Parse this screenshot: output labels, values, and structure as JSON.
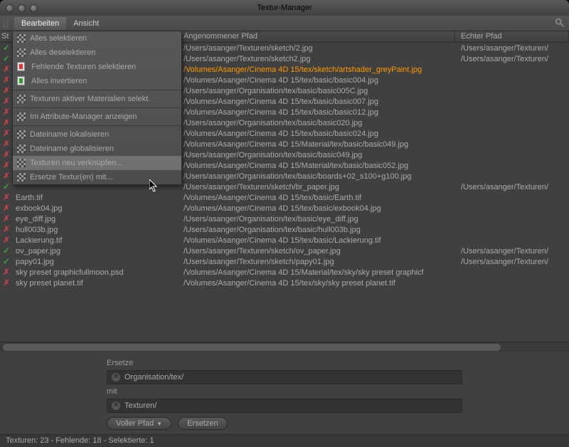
{
  "title": "Textur-Manager",
  "menu": {
    "edit": "Bearbeiten",
    "view": "Ansicht"
  },
  "cols": {
    "st": "St",
    "tex": "",
    "path": "Angenommener Pfad",
    "real": "Echter Pfad"
  },
  "dd": [
    "Alles selektieren",
    "Alles deselektieren",
    "Fehlende Texturen selektieren",
    "Alles invertieren",
    "Texturen aktiver Materialien selekt.",
    "Im Attribute-Manager anzeigen",
    "Dateiname lokalisieren",
    "Dateiname globalisieren",
    "Texturen neu verknüpfen...",
    "Ersetze Textur(en) mit..."
  ],
  "rows": [
    {
      "s": "ok",
      "p": "/Users/asanger/Texturen/sketch/2.jpg",
      "r": "/Users/asanger/Texturen/"
    },
    {
      "s": "ok",
      "p": "/Users/asanger/Texturen/sketch2.jpg",
      "r": "/Users/asanger/Texturen/"
    },
    {
      "s": "miss",
      "p": "/Volumes/Asanger/Cinema 4D 15/tex/sketch/artshader_greyPaint.jpg",
      "hl": true
    },
    {
      "s": "miss",
      "p": "/Volumes/Asanger/Cinema 4D 15/tex/basic/basic004.jpg"
    },
    {
      "s": "miss",
      "p": "/Users/asanger/Organisation/tex/basic/basic005C.jpg"
    },
    {
      "s": "miss",
      "p": "/Volumes/Asanger/Cinema 4D 15/tex/basic/basic007.jpg"
    },
    {
      "s": "miss",
      "p": "/Volumes/Asanger/Cinema 4D 15/tex/basic/basic012.jpg"
    },
    {
      "s": "miss",
      "p": "/Users/asanger/Organisation/tex/basic/basic020.jpg"
    },
    {
      "s": "miss",
      "p": "/Volumes/Asanger/Cinema 4D 15/tex/basic/basic024.jpg"
    },
    {
      "s": "miss",
      "p": "/Volumes/Asanger/Cinema 4D 15/Material/tex/basic/basic049.jpg"
    },
    {
      "s": "miss",
      "p": "/Users/asanger/Organisation/tex/basic/basic049.jpg"
    },
    {
      "s": "miss",
      "p": "/Volumes/Asanger/Cinema 4D 15/Material/tex/basic/basic052.jpg"
    },
    {
      "s": "miss",
      "p": "/Users/asanger/Organisation/tex/basic/boards+02_s100+g100.jpg"
    },
    {
      "s": "ok",
      "t": "",
      "p": "/Users/asanger/Texturen/sketch/br_paper.jpg",
      "r": "/Users/asanger/Texturen/"
    },
    {
      "s": "miss",
      "t": "Earth.tif",
      "p": "/Volumes/Asanger/Cinema 4D 15/tex/basic/Earth.tif"
    },
    {
      "s": "miss",
      "t": "exbook04.jpg",
      "p": "/Volumes/Asanger/Cinema 4D 15/tex/basic/exbook04.jpg"
    },
    {
      "s": "miss",
      "t": "eye_diff.jpg",
      "p": "/Users/asanger/Organisation/tex/basic/eye_diff.jpg"
    },
    {
      "s": "miss",
      "t": "hull003b.jpg",
      "p": "/Users/asanger/Organisation/tex/basic/hull003b.jpg"
    },
    {
      "s": "miss",
      "t": "Lackierung.tif",
      "p": "/Volumes/Asanger/Cinema 4D 15/tex/basic/Lackierung.tif"
    },
    {
      "s": "ok",
      "t": "ov_paper.jpg",
      "p": "/Users/asanger/Texturen/sketch/ov_paper.jpg",
      "r": "/Users/asanger/Texturen/"
    },
    {
      "s": "ok",
      "t": "papy01.jpg",
      "p": "/Users/asanger/Texturen/sketch/papy01.jpg",
      "r": "/Users/asanger/Texturen/"
    },
    {
      "s": "miss",
      "t": "sky preset graphicfullmoon.psd",
      "p": "/Volumes/Asanger/Cinema 4D 15/Material/tex/sky/sky preset graphicf"
    },
    {
      "s": "miss",
      "t": "sky preset planet.tif",
      "p": "/Volumes/Asanger/Cinema 4D 15/tex/sky/sky preset planet.tif"
    }
  ],
  "replace": {
    "l1": "Ersetze",
    "v1": "Organisation/tex/",
    "l2": "mit",
    "v2": "Texturen/",
    "mode": "Voller Pfad",
    "btn": "Ersetzen"
  },
  "status": "Texturen: 23 - Fehlende: 18 - Selektierte: 1"
}
